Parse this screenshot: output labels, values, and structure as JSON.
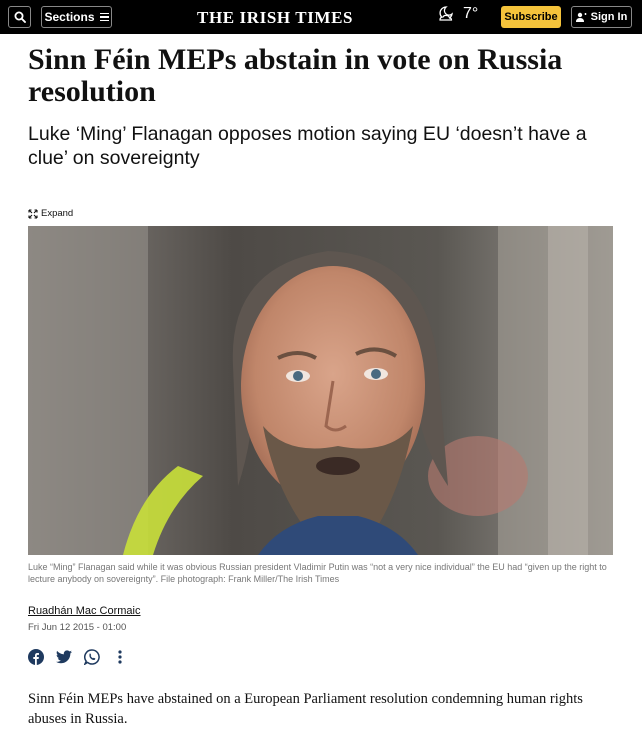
{
  "nav": {
    "sections_label": "Sections",
    "logo": "THE IRISH TIMES",
    "temperature": "7°",
    "subscribe_label": "Subscribe",
    "signin_label": "Sign In"
  },
  "article": {
    "headline": "Sinn Féin MEPs abstain in vote on Russia resolution",
    "standfirst": "Luke ‘Ming’ Flanagan opposes motion saying EU ‘doesn’t have a clue’ on sovereignty",
    "expand_label": "Expand",
    "caption": "Luke “Ming” Flanagan said while it was obvious Russian president Vladimir Putin was “not a very nice individual” the EU had “given up the right to lecture anybody on sovereignty”. File photograph: Frank Miller/The Irish Times",
    "author": "Ruadhán Mac Cormaic",
    "date": "Fri Jun 12 2015 - 01:00",
    "body": "Sinn Féin MEPs have abstained on a European Parliament resolution condemning human rights abuses in Russia."
  },
  "icons": {
    "search": "search-icon",
    "menu": "hamburger-icon",
    "weather": "moon-cloud-icon",
    "user": "user-icon",
    "expand": "expand-icon",
    "share": [
      "facebook-icon",
      "twitter-icon",
      "whatsapp-icon",
      "more-vertical-icon"
    ]
  },
  "colors": {
    "topbar": "#000000",
    "subscribe": "#f5c33b",
    "text": "#111111",
    "caption": "#777777"
  }
}
